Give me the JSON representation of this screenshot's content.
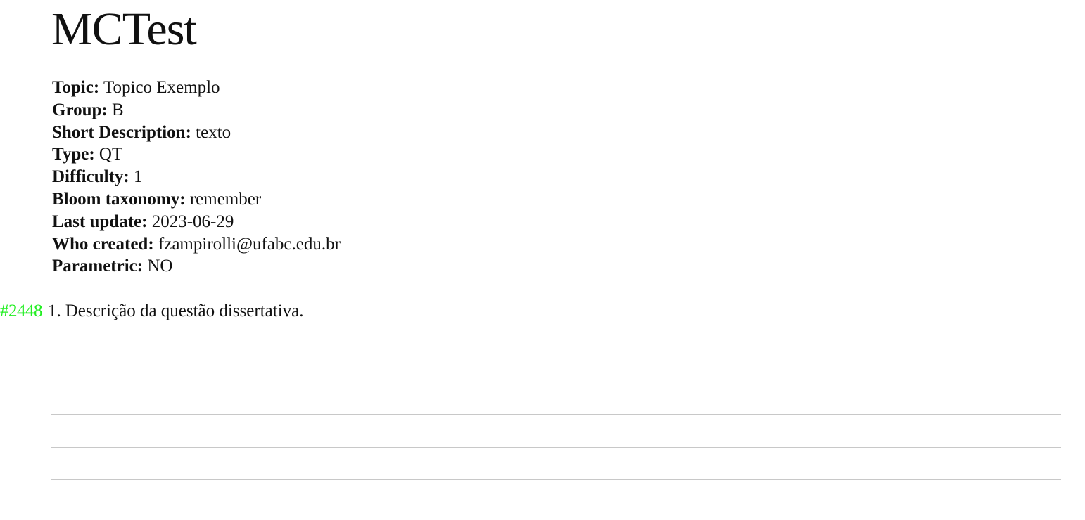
{
  "document": {
    "title": "MCTest"
  },
  "meta": [
    {
      "key": "Topic:",
      "value": "Topico Exemplo"
    },
    {
      "key": "Group:",
      "value": "B"
    },
    {
      "key": "Short Description:",
      "value": "texto"
    },
    {
      "key": "Type:",
      "value": "QT"
    },
    {
      "key": "Difficulty:",
      "value": "1"
    },
    {
      "key": "Bloom taxonomy:",
      "value": "remember"
    },
    {
      "key": "Last update:",
      "value": "2023-06-29"
    },
    {
      "key": "Who created:",
      "value": "fzampirolli@ufabc.edu.br"
    },
    {
      "key": "Parametric:",
      "value": "NO"
    }
  ],
  "question": {
    "id": "#2448",
    "number": "1.",
    "text": "Descrição da questão dissertativa.",
    "id_color": "#22ee22"
  },
  "answer_line_count": 5
}
